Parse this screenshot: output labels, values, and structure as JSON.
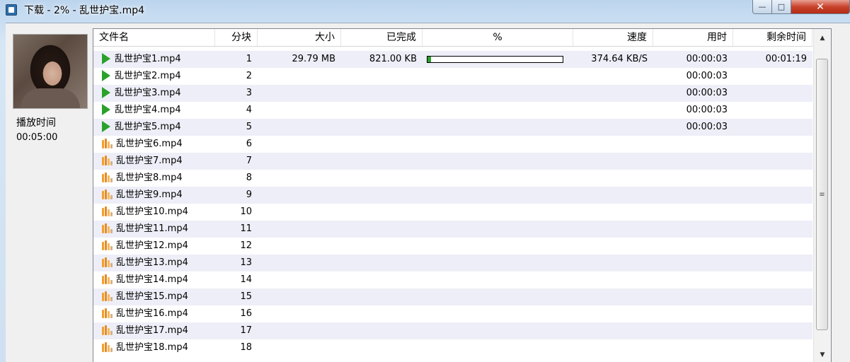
{
  "window": {
    "title": "下载 - 2% - 乱世护宝.mp4",
    "controls": {
      "minimize": "—",
      "maximize": "□",
      "close": "✕"
    }
  },
  "sidebar": {
    "play_time_label": "播放时间",
    "play_time_value": "00:05:00"
  },
  "list": {
    "columns": [
      "文件名",
      "分块",
      "大小",
      "已完成",
      "%",
      "速度",
      "用时",
      "剩余时间"
    ],
    "rows": [
      {
        "icon": "play-icon",
        "name": "乱世护宝1.mp4",
        "block": "1",
        "size": "29.79 MB",
        "done": "821.00 KB",
        "progress": 0.028,
        "speed": "374.64 KB/S",
        "time": "00:00:03",
        "remaining": "00:01:19"
      },
      {
        "icon": "play-icon",
        "name": "乱世护宝2.mp4",
        "block": "2",
        "size": "",
        "done": "",
        "speed": "",
        "time": "00:00:03",
        "remaining": ""
      },
      {
        "icon": "play-icon",
        "name": "乱世护宝3.mp4",
        "block": "3",
        "size": "",
        "done": "",
        "speed": "",
        "time": "00:00:03",
        "remaining": ""
      },
      {
        "icon": "play-icon",
        "name": "乱世护宝4.mp4",
        "block": "4",
        "size": "",
        "done": "",
        "speed": "",
        "time": "00:00:03",
        "remaining": ""
      },
      {
        "icon": "play-icon",
        "name": "乱世护宝5.mp4",
        "block": "5",
        "size": "",
        "done": "",
        "speed": "",
        "time": "00:00:03",
        "remaining": ""
      },
      {
        "icon": "waiting-icon",
        "name": "乱世护宝6.mp4",
        "block": "6"
      },
      {
        "icon": "waiting-icon",
        "name": "乱世护宝7.mp4",
        "block": "7"
      },
      {
        "icon": "waiting-icon",
        "name": "乱世护宝8.mp4",
        "block": "8"
      },
      {
        "icon": "waiting-icon",
        "name": "乱世护宝9.mp4",
        "block": "9"
      },
      {
        "icon": "waiting-icon",
        "name": "乱世护宝10.mp4",
        "block": "10"
      },
      {
        "icon": "waiting-icon",
        "name": "乱世护宝11.mp4",
        "block": "11"
      },
      {
        "icon": "waiting-icon",
        "name": "乱世护宝12.mp4",
        "block": "12"
      },
      {
        "icon": "waiting-icon",
        "name": "乱世护宝13.mp4",
        "block": "13"
      },
      {
        "icon": "waiting-icon",
        "name": "乱世护宝14.mp4",
        "block": "14"
      },
      {
        "icon": "waiting-icon",
        "name": "乱世护宝15.mp4",
        "block": "15"
      },
      {
        "icon": "waiting-icon",
        "name": "乱世护宝16.mp4",
        "block": "16"
      },
      {
        "icon": "waiting-icon",
        "name": "乱世护宝17.mp4",
        "block": "17"
      },
      {
        "icon": "waiting-icon",
        "name": "乱世护宝18.mp4",
        "block": "18"
      }
    ]
  },
  "scrollbar": {
    "up": "▲",
    "down": "▼",
    "grip": "≡"
  },
  "colors": {
    "accent_green": "#2aa12a",
    "waiting_orange": "#e88a20",
    "alt_row": "#eeeef8"
  }
}
